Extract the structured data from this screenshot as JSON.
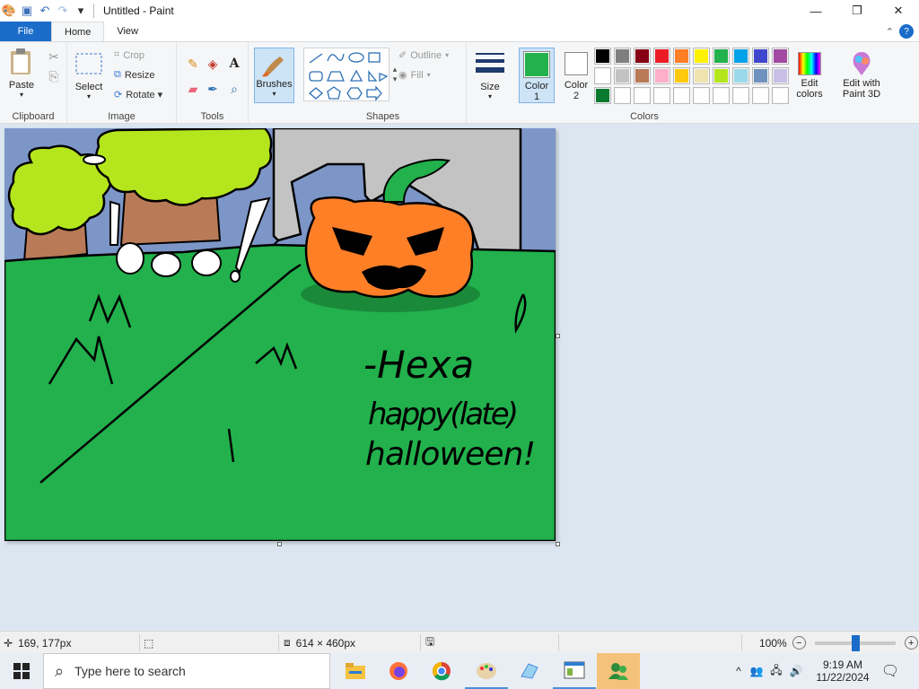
{
  "app": {
    "title": "Untitled - Paint",
    "window_controls": {
      "minimize": "—",
      "maximize": "❐",
      "close": "✕"
    }
  },
  "quick_access": {
    "save": "💾",
    "undo": "↶",
    "redo": "↷",
    "customize": "▾"
  },
  "tabs": {
    "file": "File",
    "home": "Home",
    "view": "View",
    "collapse": "⌃",
    "help": "?"
  },
  "ribbon": {
    "clipboard": {
      "label": "Clipboard",
      "paste": "Paste"
    },
    "image": {
      "label": "Image",
      "select": "Select",
      "crop": "Crop",
      "resize": "Resize",
      "rotate": "Rotate ▾"
    },
    "tools": {
      "label": "Tools"
    },
    "brushes": {
      "label": "Brushes"
    },
    "shapes": {
      "label": "Shapes",
      "outline": "Outline",
      "fill": "Fill"
    },
    "size": {
      "label": "Size"
    },
    "colors": {
      "label": "Colors",
      "color1_label": "Color",
      "color1_num": "1",
      "color2_label": "Color",
      "color2_num": "2",
      "color1_value": "#22b14c",
      "color2_value": "#ffffff",
      "edit_colors_1": "Edit",
      "edit_colors_2": "colors",
      "paint3d_1": "Edit with",
      "paint3d_2": "Paint 3D",
      "palette": [
        "#000000",
        "#7f7f7f",
        "#880015",
        "#ed1c24",
        "#ff7f27",
        "#fff200",
        "#22b14c",
        "#00a2e8",
        "#3f48cc",
        "#a349a4",
        "#ffffff",
        "#c3c3c3",
        "#b97a57",
        "#ffaec9",
        "#ffc90e",
        "#efe4b0",
        "#b5e61d",
        "#99d9ea",
        "#7092be",
        "#c8bfe7",
        "#0a7a2f",
        "#ffffff",
        "#ffffff",
        "#ffffff",
        "#ffffff",
        "#ffffff",
        "#ffffff",
        "#ffffff",
        "#ffffff",
        "#ffffff"
      ]
    }
  },
  "canvas_drawing": {
    "signature": "-Hexa",
    "message_line1": "happy(late)",
    "message_line2": "halloween!"
  },
  "status": {
    "cursor_pos": "169, 177px",
    "canvas_size": "614 × 460px",
    "zoom": "100%",
    "zoom_level": 0.5
  },
  "taskbar": {
    "search_placeholder": "Type here to search",
    "time": "9:19 AM",
    "date": "11/22/2024"
  }
}
